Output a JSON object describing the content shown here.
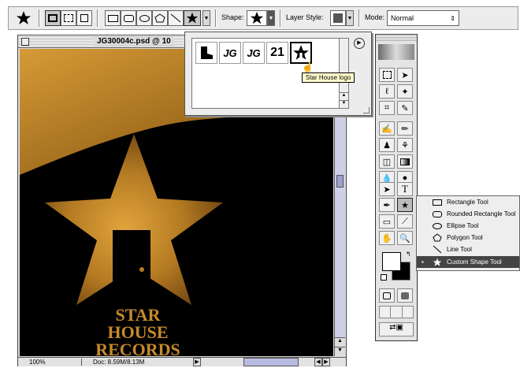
{
  "options_bar": {
    "shape_label": "Shape:",
    "layer_style_label": "Layer Style:",
    "mode_label": "Mode:",
    "mode_value": "Normal"
  },
  "document": {
    "title": "JG30004c.psd @ 10",
    "zoom": "100%",
    "doc_size": "Doc: 8.59M/8.13M",
    "artwork_text": [
      "STAR",
      "HOUSE",
      "RECORDS"
    ]
  },
  "shape_picker": {
    "shapes": [
      "Boot",
      "JG",
      "JG",
      "21",
      "Star House logo"
    ],
    "tooltip": "Star House logo"
  },
  "tool_flyout": {
    "items": [
      "Rectangle Tool",
      "Rounded Rectangle Tool",
      "Ellipse Tool",
      "Polygon Tool",
      "Line Tool",
      "Custom Shape Tool"
    ],
    "selected_index": 5
  },
  "colors": {
    "wood": "#b47a22",
    "background": "#000000",
    "selection": "#444444"
  }
}
